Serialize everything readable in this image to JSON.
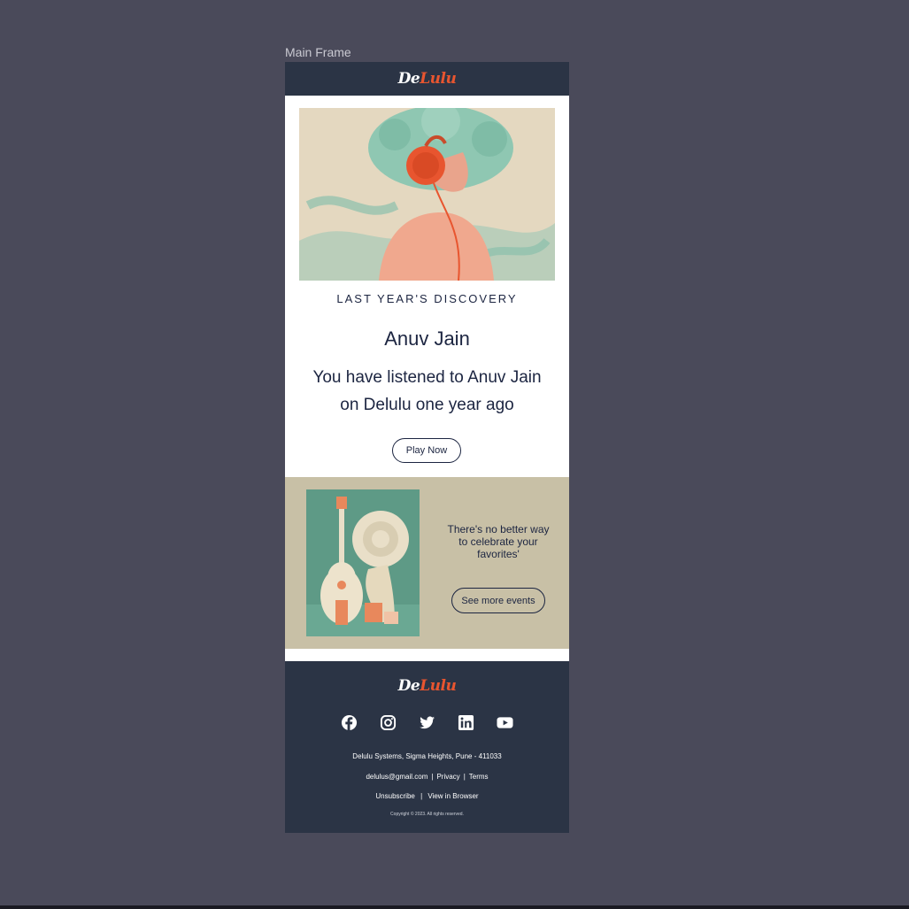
{
  "canvas": {
    "frame_label": "Main Frame"
  },
  "email": {
    "logo": {
      "part1": "De",
      "part2": "Lulu"
    },
    "eyebrow": "LAST YEAR'S DISCOVERY",
    "artist": "Anuv Jain",
    "message": "You have listened to Anuv Jain on Delulu one year ago",
    "play_button": "Play Now",
    "promo": {
      "text": "There's no better way to celebrate your favorites'",
      "button": "See more events"
    },
    "footer": {
      "socials": [
        "facebook-icon",
        "instagram-icon",
        "twitter-icon",
        "linkedin-icon",
        "youtube-icon"
      ],
      "address": "Delulu Systems, Sigma Heights, Pune - 411033",
      "email": "delulus@gmail.com",
      "privacy": "Privacy",
      "terms": "Terms",
      "unsubscribe": "Unsubscribe",
      "view_browser": "View in Browser",
      "copyright": "Copyright © 2023. All rights reserved."
    }
  },
  "colors": {
    "canvas_bg": "#4a4a5a",
    "header_bg": "#2b3445",
    "accent": "#e8552f",
    "text_dark": "#1c2541",
    "promo_bg": "#c8c0a6"
  }
}
